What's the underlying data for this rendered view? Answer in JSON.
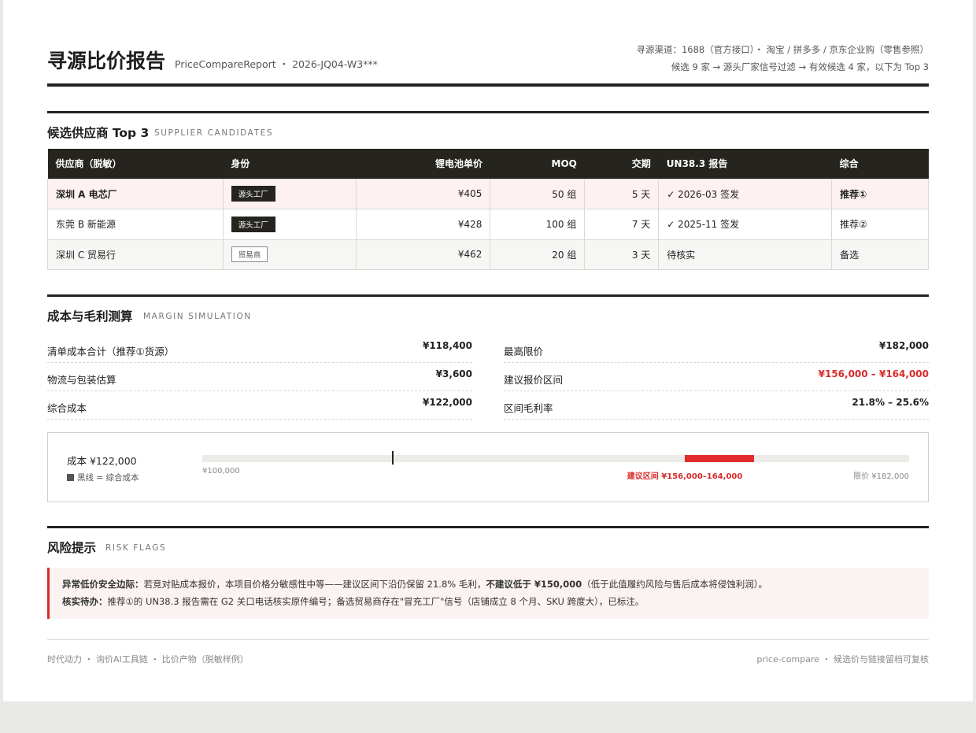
{
  "header": {
    "title": "寻源比价报告",
    "subtitle": "PriceCompareReport ・ 2026-JQ04-W3***",
    "channels_line1": "寻源渠道：1688（官方接口）・ 淘宝 / 拼多多 / 京东企业购（零售参照）",
    "channels_line2": "候选 9 家 → 源头厂家信号过滤 → 有效候选 4 家，以下为 Top 3"
  },
  "suppliers": {
    "title": "候选供应商 Top 3",
    "subtitle": "SUPPLIER CANDIDATES",
    "columns": [
      "供应商（脱敏）",
      "身份",
      "锂电池单价",
      "MOQ",
      "交期",
      "UN38.3 报告",
      "综合"
    ],
    "rows": [
      {
        "name": "深圳 A 电芯厂",
        "identity": "源头工厂",
        "price": "¥405",
        "moq": "50 组",
        "lead": "5 天",
        "un383": "✓ 2026-03 签发",
        "overall": "推荐①"
      },
      {
        "name": "东莞 B 新能源",
        "identity": "源头工厂",
        "price": "¥428",
        "moq": "100 组",
        "lead": "7 天",
        "un383": "✓ 2025-11 签发",
        "overall": "推荐②"
      },
      {
        "name": "深圳 C 贸易行",
        "identity": "贸易商",
        "price": "¥462",
        "moq": "20 组",
        "lead": "3 天",
        "un383": "待核实",
        "overall": "备选"
      }
    ]
  },
  "margin": {
    "title": "成本与毛利测算",
    "subtitle": "MARGIN SIMULATION",
    "left": [
      {
        "label": "清单成本合计（推荐①货源）",
        "value": "¥118,400"
      },
      {
        "label": "物流与包装估算",
        "value": "¥3,600"
      },
      {
        "label": "综合成本",
        "value": "¥122,000"
      }
    ],
    "right": [
      {
        "label": "最高限价",
        "value": "¥182,000"
      },
      {
        "label": "建议报价区间",
        "value": "¥156,000 – ¥164,000"
      },
      {
        "label": "区间毛利率",
        "value": "21.8% – 25.6%"
      }
    ]
  },
  "bar": {
    "cost_label": "成本 ¥122,000",
    "legend": "黑线 = 综合成本",
    "min_label": "¥100,000",
    "range_label": "建议区间 ¥156,000–164,000",
    "max_label": "限价 ¥182,000",
    "scale_min": 100000,
    "scale_max": 182000,
    "cost": 122000,
    "range_low": 156000,
    "range_high": 164000
  },
  "risk": {
    "title": "风险提示",
    "subtitle": "RISK FLAGS",
    "line1_head": "异常低价安全边际：",
    "line1_body": "若竞对贴成本报价，本项目价格分敏感性中等——建议区间下沿仍保留 21.8% 毛利，",
    "line1_strong": "不建议低于 ¥150,000",
    "line1_tail": "（低于此值履约风险与售后成本将侵蚀利润）。",
    "line2_head": "核实待办：",
    "line2_body": "推荐①的 UN38.3 报告需在 G2 关口电话核实原件编号；备选贸易商存在\"冒充工厂\"信号（店铺成立 8 个月、SKU 跨度大），已标注。"
  },
  "footer": {
    "left": "时代动力 ・ 询价AI工具链 ・ 比价产物（脱敏样例）",
    "right": "price-compare ・ 候选价与链接留档可复核"
  }
}
